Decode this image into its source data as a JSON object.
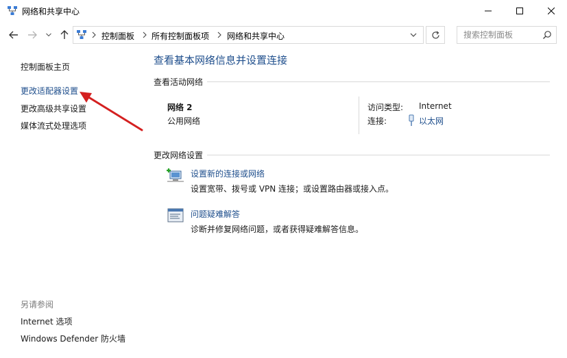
{
  "window": {
    "title": "网络和共享中心",
    "icon": "network-center-icon",
    "controls": [
      "minimize-icon",
      "maximize-icon",
      "close-icon"
    ]
  },
  "address": {
    "breadcrumbs": [
      "控制面板",
      "所有控制面板项",
      "网络和共享中心"
    ],
    "search_placeholder": "搜索控制面板"
  },
  "left_pane": {
    "home": "控制面板主页",
    "links": [
      "更改适配器设置",
      "更改高级共享设置",
      "媒体流式处理选项"
    ],
    "see_also_title": "另请参阅",
    "see_also": [
      "Internet 选项",
      "Windows Defender 防火墙"
    ]
  },
  "main": {
    "title": "查看基本网络信息并设置连接",
    "active_section": "查看活动网络",
    "network": {
      "name": "网络 2",
      "type": "公用网络",
      "access_label": "访问类型:",
      "access_value": "Internet",
      "connection_label": "连接:",
      "connection_value": "以太网"
    },
    "change_section": "更改网络设置",
    "tasks": [
      {
        "link": "设置新的连接或网络",
        "desc": "设置宽带、拨号或 VPN 连接；或设置路由器或接入点。",
        "icon": "new-connection-icon"
      },
      {
        "link": "问题疑难解答",
        "desc": "诊断并修复网络问题，或者获得疑难解答信息。",
        "icon": "troubleshoot-icon"
      }
    ]
  },
  "colors": {
    "link": "#1e4e8c",
    "annotation_arrow": "#d42020"
  }
}
